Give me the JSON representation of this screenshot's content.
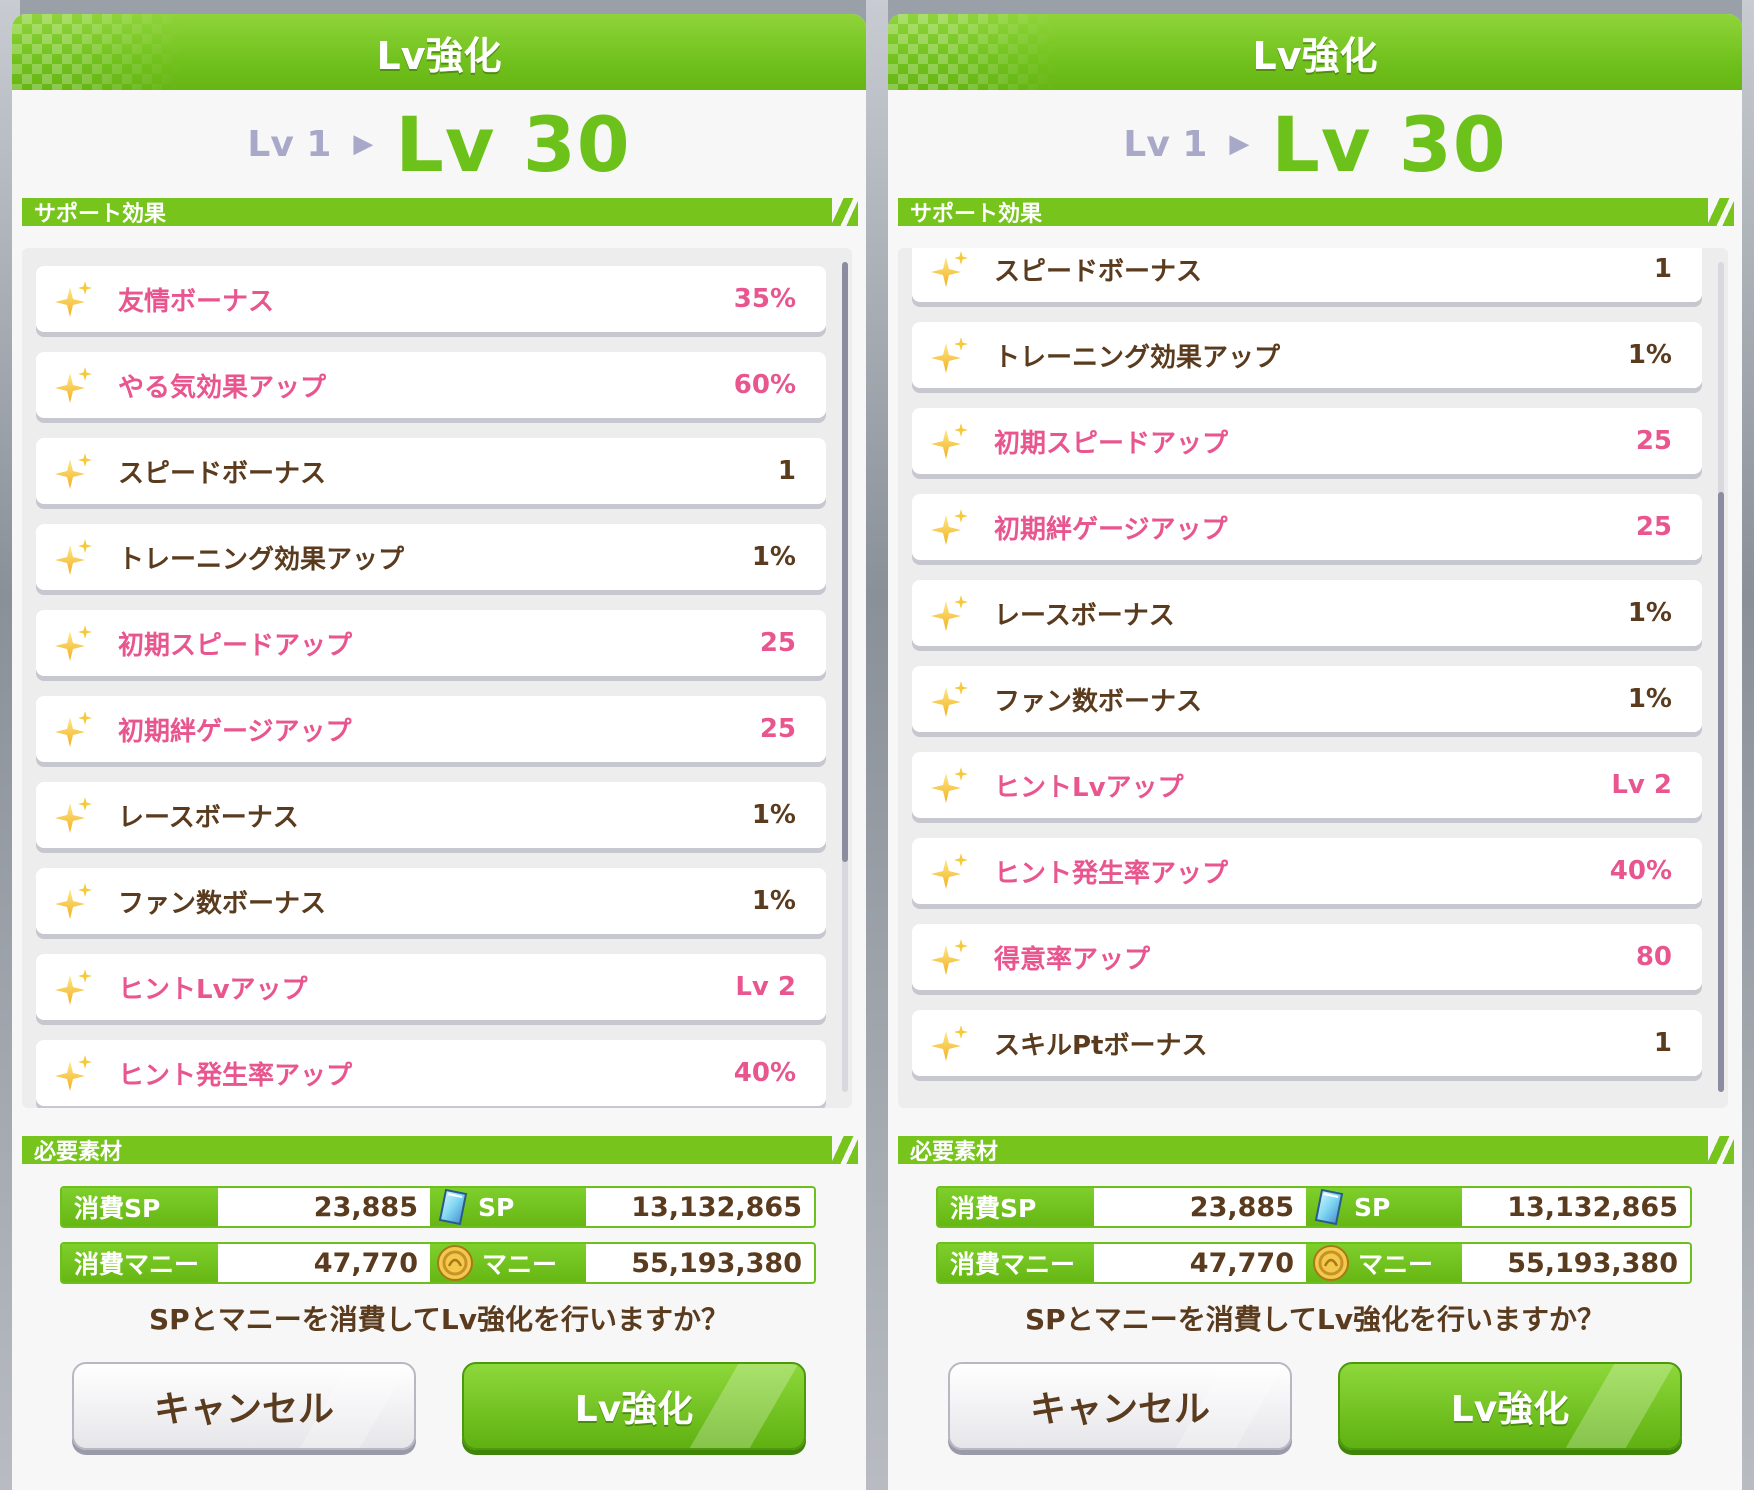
{
  "title": "Lv強化",
  "lv_from": "Lv 1",
  "lv_to": "Lv 30",
  "section_support": "サポート効果",
  "section_materials": "必要素材",
  "left_effects": [
    {
      "label": "友情ボーナス",
      "value": "35%",
      "pink": true
    },
    {
      "label": "やる気効果アップ",
      "value": "60%",
      "pink": true
    },
    {
      "label": "スピードボーナス",
      "value": "1",
      "pink": false
    },
    {
      "label": "トレーニング効果アップ",
      "value": "1%",
      "pink": false
    },
    {
      "label": "初期スピードアップ",
      "value": "25",
      "pink": true
    },
    {
      "label": "初期絆ゲージアップ",
      "value": "25",
      "pink": true
    },
    {
      "label": "レースボーナス",
      "value": "1%",
      "pink": false
    },
    {
      "label": "ファン数ボーナス",
      "value": "1%",
      "pink": false
    },
    {
      "label": "ヒントLvアップ",
      "value": "Lv 2",
      "pink": true
    },
    {
      "label": "ヒント発生率アップ",
      "value": "40%",
      "pink": true
    }
  ],
  "right_effects": [
    {
      "label": "スピードボーナス",
      "value": "1",
      "pink": false
    },
    {
      "label": "トレーニング効果アップ",
      "value": "1%",
      "pink": false
    },
    {
      "label": "初期スピードアップ",
      "value": "25",
      "pink": true
    },
    {
      "label": "初期絆ゲージアップ",
      "value": "25",
      "pink": true
    },
    {
      "label": "レースボーナス",
      "value": "1%",
      "pink": false
    },
    {
      "label": "ファン数ボーナス",
      "value": "1%",
      "pink": false
    },
    {
      "label": "ヒントLvアップ",
      "value": "Lv 2",
      "pink": true
    },
    {
      "label": "ヒント発生率アップ",
      "value": "40%",
      "pink": true
    },
    {
      "label": "得意率アップ",
      "value": "80",
      "pink": true
    },
    {
      "label": "スキルPtボーナス",
      "value": "1",
      "pink": false
    }
  ],
  "scroll_left_fraction": 0.0,
  "scroll_right_fraction": 1.0,
  "costs": {
    "sp_label": "消費SP",
    "sp_value": "23,885",
    "sp_owned_label": "SP",
    "sp_owned_value": "13,132,865",
    "money_label": "消費マニー",
    "money_value": "47,770",
    "money_owned_label": "マニー",
    "money_owned_value": "55,193,380"
  },
  "question": "SPとマニーを消費してLv強化を行いますか？",
  "buttons": {
    "cancel": "キャンセル",
    "confirm": "Lv強化"
  },
  "colors": {
    "accent_green": "#72c21e",
    "pink_text": "#e8558f",
    "brown_text": "#5a3b1e"
  },
  "icons": {
    "effect": "sparkle-icon",
    "sp": "sp-crystal-icon",
    "money": "coin-icon",
    "arrow": "triangle-right-icon"
  }
}
